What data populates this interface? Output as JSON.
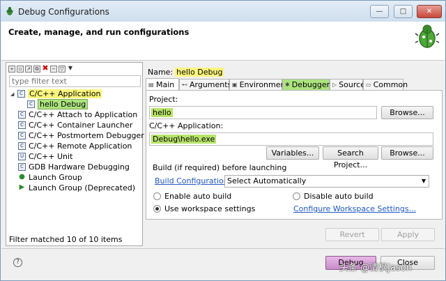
{
  "window": {
    "title": "Debug Configurations",
    "min_glyph": "—",
    "max_glyph": "□",
    "close_glyph": "✕"
  },
  "banner": {
    "heading": "Create, manage, and run configurations"
  },
  "left_panel": {
    "filter_placeholder": "type filter text",
    "tree": [
      {
        "label": "C/C++ Application",
        "icon": "c-app-icon",
        "expanded": true,
        "highlight": "yellow"
      },
      {
        "label": "hello Debug",
        "icon": "c-config-icon",
        "child": true,
        "highlight": "green"
      },
      {
        "label": "C/C++ Attach to Application",
        "icon": "c-attach-icon"
      },
      {
        "label": "C/C++ Container Launcher",
        "icon": "c-container-icon"
      },
      {
        "label": "C/C++ Postmortem Debugger",
        "icon": "c-postmortem-icon"
      },
      {
        "label": "C/C++ Remote Application",
        "icon": "c-remote-icon"
      },
      {
        "label": "C/C++ Unit",
        "icon": "c-unit-icon"
      },
      {
        "label": "GDB Hardware Debugging",
        "icon": "gdb-hardware-icon"
      },
      {
        "label": "Launch Group",
        "icon": "launch-group-icon"
      },
      {
        "label": "Launch Group (Deprecated)",
        "icon": "launch-group-deprecated-icon"
      }
    ],
    "status": "Filter matched 10 of 10 items"
  },
  "config": {
    "name_label": "Name:",
    "name_value": "hello Debug",
    "tabs": [
      {
        "label": "Main",
        "icon": "main-tab-icon",
        "active": true
      },
      {
        "label": "Arguments",
        "icon": "arguments-tab-icon"
      },
      {
        "label": "Environment",
        "icon": "environment-tab-icon"
      },
      {
        "label": "Debugger",
        "icon": "debugger-tab-icon",
        "highlight": "green"
      },
      {
        "label": "Source",
        "icon": "source-tab-icon"
      },
      {
        "label": "Common",
        "icon": "common-tab-icon"
      }
    ],
    "project_label": "Project:",
    "project_value": "hello",
    "browse_label": "Browse...",
    "app_label": "C/C++ Application:",
    "app_value": "Debug\\hello.exe",
    "variables_label": "Variables...",
    "search_project_label": "Search Project...",
    "browse2_label": "Browse...",
    "build_label": "Build (if required) before launching",
    "build_config_link": "Build Configuration:",
    "build_config_value": "Select Automatically",
    "enable_auto_build": "Enable auto build",
    "disable_auto_build": "Disable auto build",
    "use_workspace": "Use workspace settings",
    "configure_workspace_link": "Configure Workspace Settings...",
    "selected_radio": "use_workspace"
  },
  "actions": {
    "revert": "Revert",
    "apply": "Apply",
    "debug": "Debug",
    "close": "Close",
    "help_glyph": "?"
  },
  "watermark": "头条 @清枫Jason",
  "colors": {
    "highlight_yellow": "#fbf57d",
    "highlight_green": "#ace37e",
    "link_blue": "#1c57c4"
  }
}
